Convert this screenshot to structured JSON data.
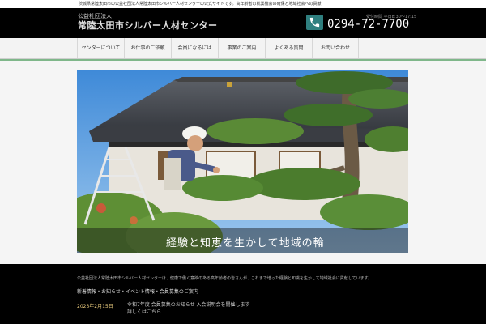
{
  "topbar": {
    "text": "茨城県常陸太田市の公益社団法人常陸太田市シルバー人材センターの公式サイトです。高年齢者の就業機会の確保と地域社会への貢献"
  },
  "header": {
    "org_type": "公益社団法人",
    "org_name": "常陸太田市シルバー人材センター",
    "phone_hours": "受付時間 平日8:30〜17:15",
    "phone_number": "0294-72-7700"
  },
  "nav": {
    "items": [
      {
        "label": "センターについて"
      },
      {
        "label": "お仕事のご依頼"
      },
      {
        "label": "会員になるには"
      },
      {
        "label": "事業のご案内"
      },
      {
        "label": "よくある質問"
      },
      {
        "label": "お問い合わせ"
      }
    ]
  },
  "hero": {
    "caption": "経験と知恵を生かして地域の輪"
  },
  "lower": {
    "intro": "公益社団法人常陸太田市シルバー人材センターは、健康で働く意欲のある高年齢者の皆さんが、これまで培った経験と知識を生かして地域社会に貢献しています。",
    "news_title": "新着情報・お知らせ・イベント情報・会員募集のご案内",
    "news_date": "2023年2月15日",
    "news_text": "令和7年度 会員募集のお知らせ 入会説明会を開催します",
    "news_text2": "詳しくはこちら"
  },
  "colors": {
    "accent_green": "#7fb78a",
    "phone_icon_bg": "#2f7f7f",
    "date_color": "#f0d080"
  }
}
